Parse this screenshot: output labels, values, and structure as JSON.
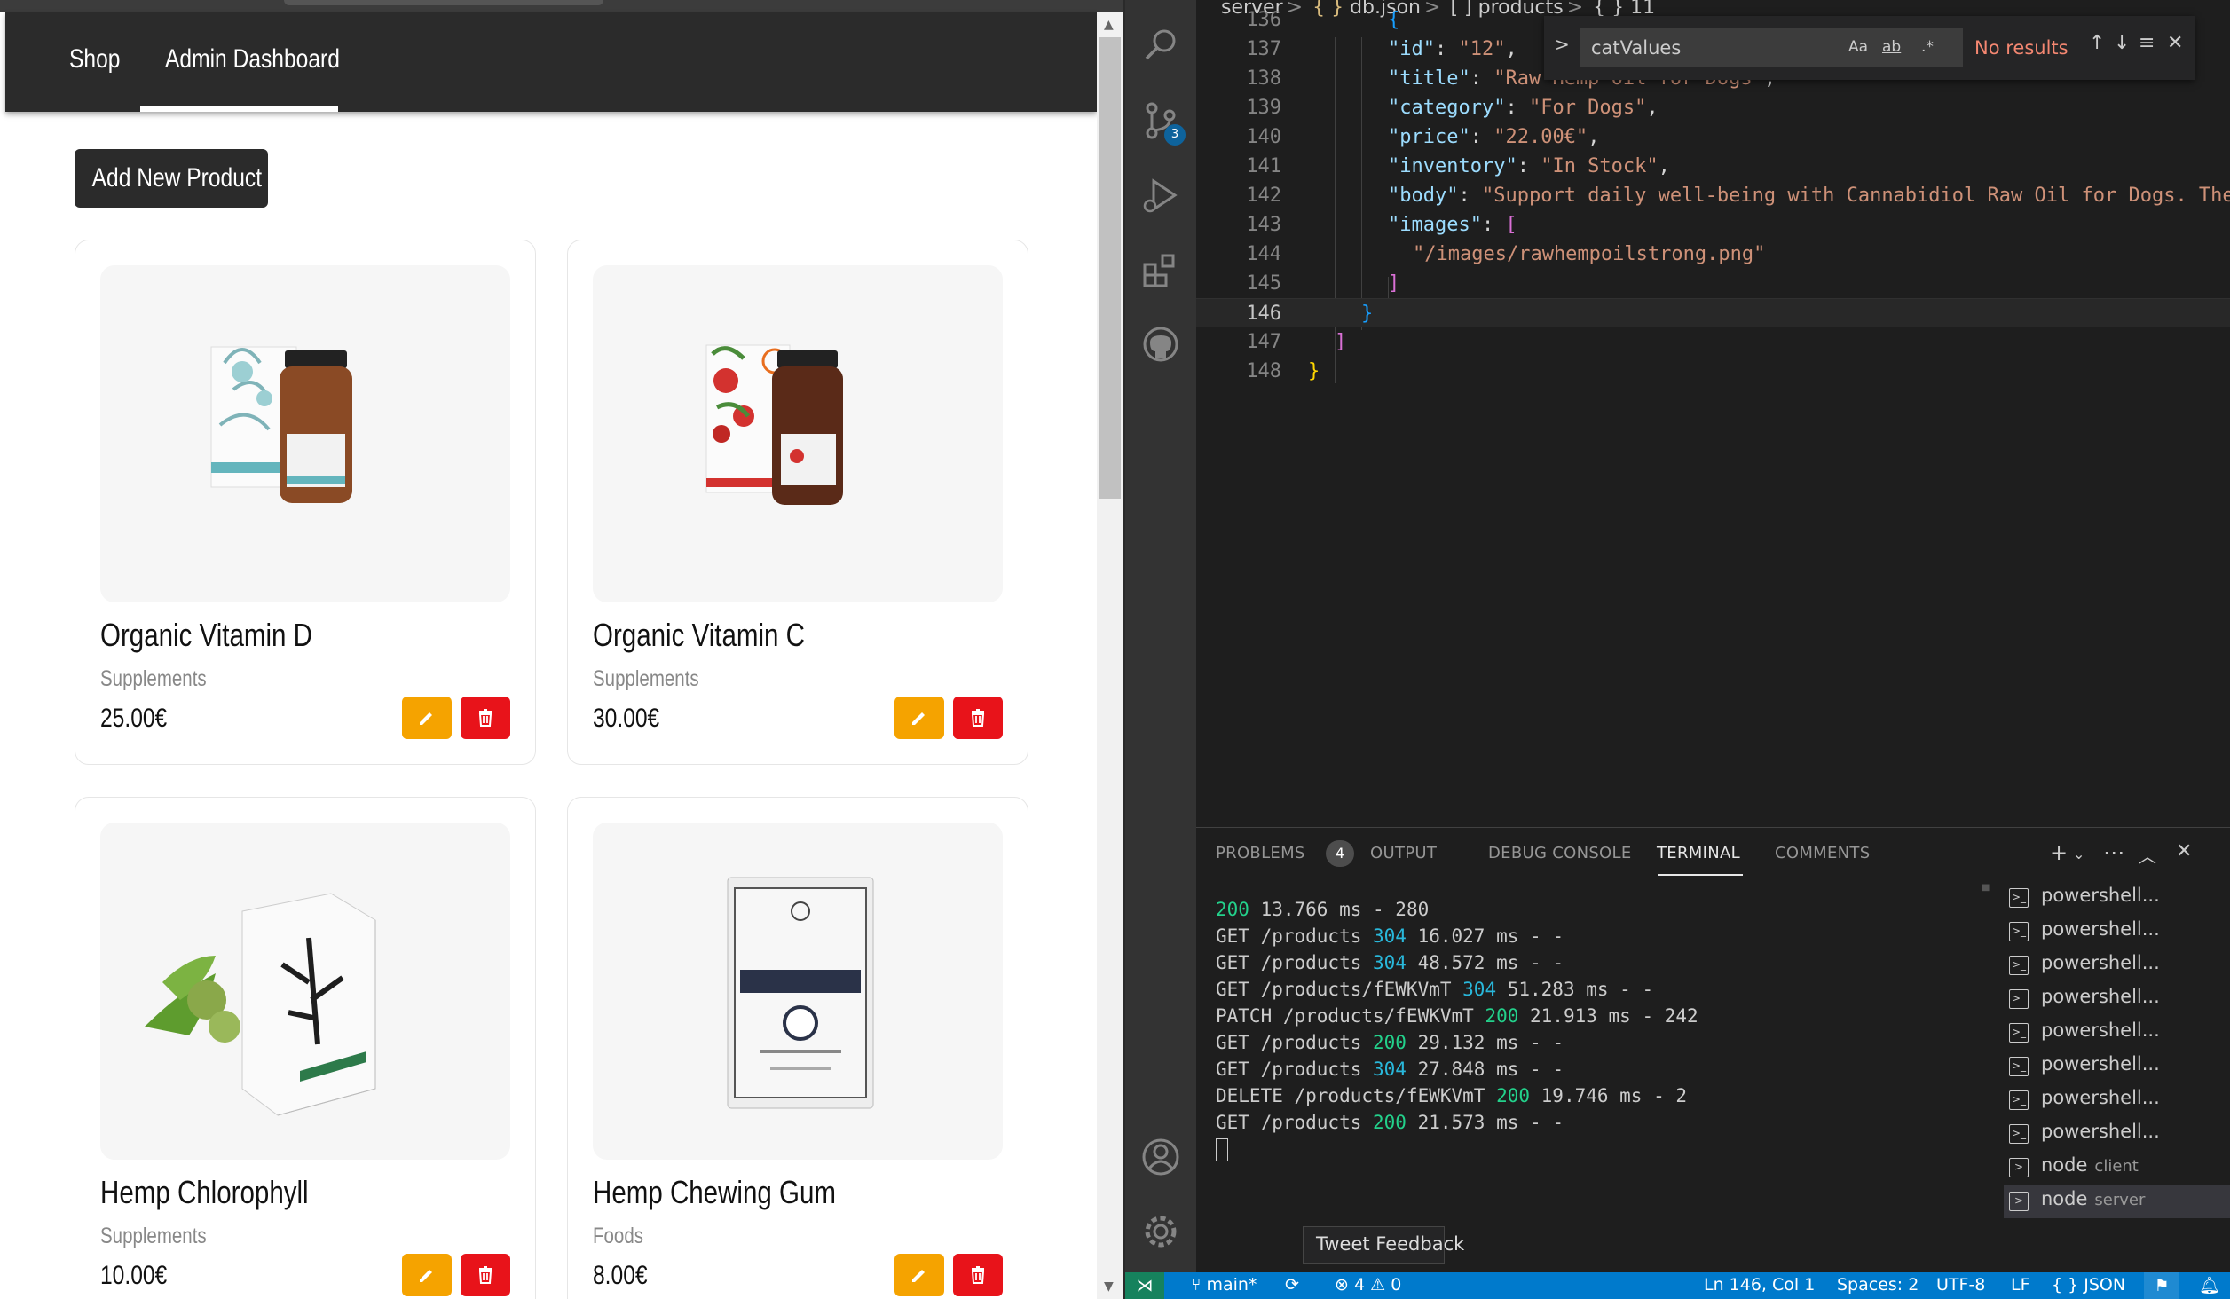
{
  "browser": {
    "nav": {
      "shop": "Shop",
      "admin": "Admin Dashboard"
    },
    "add_button": "Add New Product",
    "products": [
      {
        "title": "Organic Vitamin D",
        "category": "Supplements",
        "price": "25.00€"
      },
      {
        "title": "Organic Vitamin C",
        "category": "Supplements",
        "price": "30.00€"
      },
      {
        "title": "Hemp Chlorophyll",
        "category": "Supplements",
        "price": "10.00€"
      },
      {
        "title": "Hemp Chewing Gum",
        "category": "Foods",
        "price": "8.00€"
      }
    ],
    "colors": {
      "edit": "#f5a300",
      "delete": "#e8131a",
      "nav": "#2b2b2b"
    }
  },
  "editor": {
    "breadcrumb": [
      "server",
      "{ }",
      "db.json",
      "[ ]",
      "products",
      "{ }",
      "11"
    ],
    "lines": [
      {
        "n": "136",
        "t": ""
      },
      {
        "n": "137",
        "key": "\"id\"",
        "val": "\"12\"",
        "end": ","
      },
      {
        "n": "138",
        "key": "\"title\"",
        "val": "\"Raw Hemp Oil for Dogs\"",
        "end": ","
      },
      {
        "n": "139",
        "key": "\"category\"",
        "val": "\"For Dogs\"",
        "end": ","
      },
      {
        "n": "140",
        "key": "\"price\"",
        "val": "\"22.00€\"",
        "end": ","
      },
      {
        "n": "141",
        "key": "\"inventory\"",
        "val": "\"In Stock\"",
        "end": ","
      },
      {
        "n": "142",
        "key": "\"body\"",
        "val": "\"Support daily well-being with Cannabidiol Raw Oil for Dogs. The",
        "end": ""
      },
      {
        "n": "143",
        "key": "\"images\"",
        "val": "",
        "end": ""
      },
      {
        "n": "144",
        "t": "\"/images/rawhempoilstrong.png\""
      },
      {
        "n": "145",
        "t": "]"
      },
      {
        "n": "146",
        "t": "}"
      },
      {
        "n": "147",
        "t": "]"
      },
      {
        "n": "148",
        "t": "}"
      }
    ],
    "find": {
      "value": "catValues",
      "opt_case": "Aa",
      "opt_word": "ab",
      "opt_regex": ".*",
      "result": "No results"
    }
  },
  "panel": {
    "tabs": [
      "PROBLEMS",
      "OUTPUT",
      "DEBUG CONSOLE",
      "TERMINAL",
      "COMMENTS"
    ],
    "problems_count": "4",
    "terminal": [
      {
        "a": "",
        "code": "200",
        "b": " 13.766 ms - 280",
        "cc": "g"
      },
      {
        "a": "GET /products ",
        "code": "304",
        "b": " 16.027 ms - -",
        "cc": "c"
      },
      {
        "a": "GET /products ",
        "code": "304",
        "b": " 48.572 ms - -",
        "cc": "c"
      },
      {
        "a": "GET /products/fEWKVmT ",
        "code": "304",
        "b": " 51.283 ms - -",
        "cc": "c"
      },
      {
        "a": "PATCH /products/fEWKVmT ",
        "code": "200",
        "b": " 21.913 ms - 242",
        "cc": "g"
      },
      {
        "a": "GET /products ",
        "code": "200",
        "b": " 29.132 ms - -",
        "cc": "g"
      },
      {
        "a": "GET /products ",
        "code": "304",
        "b": " 27.848 ms - -",
        "cc": "c"
      },
      {
        "a": "DELETE /products/fEWKVmT ",
        "code": "200",
        "b": " 19.746 ms - 2",
        "cc": "g"
      },
      {
        "a": "GET /products ",
        "code": "200",
        "b": " 21.573 ms - -",
        "cc": "g"
      }
    ],
    "terminals": [
      {
        "name": "powershell...",
        "sub": ""
      },
      {
        "name": "powershell...",
        "sub": ""
      },
      {
        "name": "powershell...",
        "sub": ""
      },
      {
        "name": "powershell...",
        "sub": ""
      },
      {
        "name": "powershell...",
        "sub": ""
      },
      {
        "name": "powershell...",
        "sub": ""
      },
      {
        "name": "powershell...",
        "sub": ""
      },
      {
        "name": "powershell...",
        "sub": ""
      },
      {
        "name": "node",
        "sub": "client"
      },
      {
        "name": "node",
        "sub": "server"
      }
    ],
    "tweet": "Tweet Feedback"
  },
  "statusbar": {
    "branch": "main*",
    "errors": "4",
    "warnings": "0",
    "position": "Ln 146, Col 1",
    "spaces": "Spaces: 2",
    "encoding": "UTF-8",
    "eol": "LF",
    "language": "JSON",
    "language_icon": "{ }"
  },
  "activity": {
    "scm_badge": "3"
  }
}
